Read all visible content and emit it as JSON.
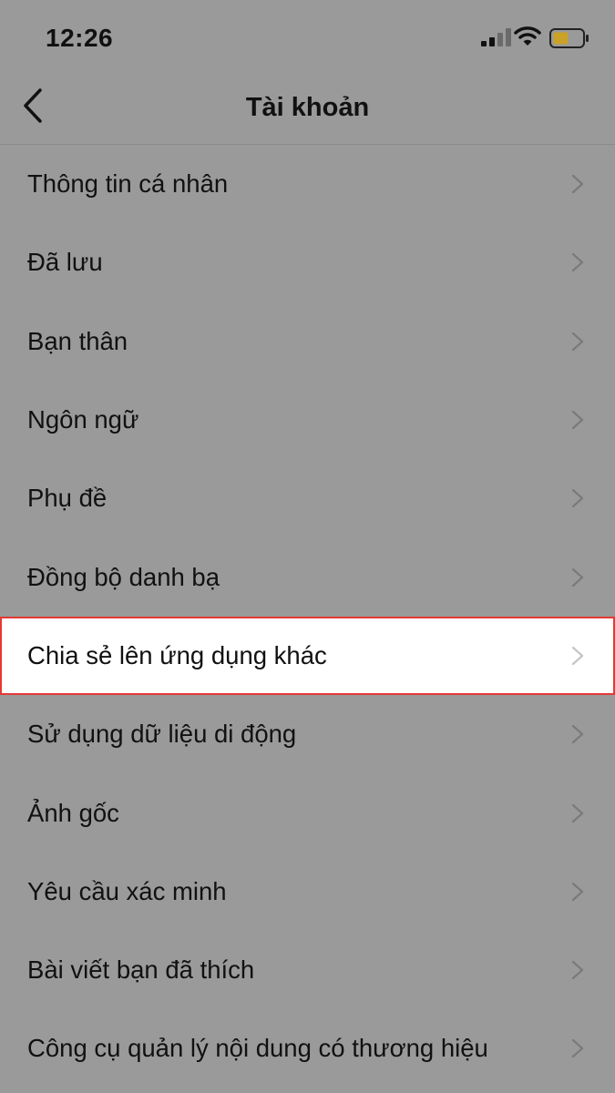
{
  "status_bar": {
    "time": "12:26",
    "signal_icon": "cellular-signal-icon",
    "wifi_icon": "wifi-icon",
    "battery_icon": "battery-low-icon",
    "battery_color": "#c9a227"
  },
  "nav": {
    "back_icon": "chevron-left-icon",
    "title": "Tài khoản"
  },
  "menu": {
    "items": [
      {
        "label": "Thông tin cá nhân"
      },
      {
        "label": "Đã lưu"
      },
      {
        "label": "Bạn thân"
      },
      {
        "label": "Ngôn ngữ"
      },
      {
        "label": "Phụ đề"
      },
      {
        "label": "Đồng bộ danh bạ"
      },
      {
        "label": "Chia sẻ lên ứng dụng khác",
        "highlighted": true
      },
      {
        "label": "Sử dụng dữ liệu di động"
      },
      {
        "label": "Ảnh gốc"
      },
      {
        "label": "Yêu cầu xác minh"
      },
      {
        "label": "Bài viết bạn đã thích"
      },
      {
        "label": "Công cụ quản lý nội dung có thương hiệu"
      }
    ],
    "chevron_icon": "chevron-right-icon"
  },
  "colors": {
    "overlay_background": "#9a9a9a",
    "highlight_background": "#ffffff",
    "highlight_border": "#e53935"
  }
}
